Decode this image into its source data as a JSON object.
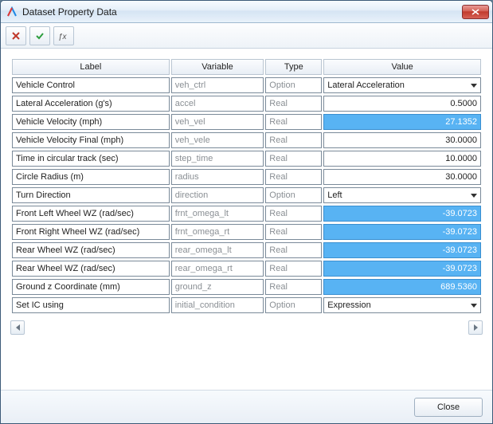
{
  "window": {
    "title": "Dataset Property Data"
  },
  "toolbar": {
    "cancel_icon": "cancel-icon",
    "apply_icon": "check-icon",
    "fx_icon": "fx-icon"
  },
  "columns": {
    "label": "Label",
    "variable": "Variable",
    "type": "Type",
    "value": "Value"
  },
  "rows": [
    {
      "label": "Vehicle Control",
      "variable": "veh_ctrl",
      "type": "Option",
      "value": "Lateral Acceleration",
      "highlight": false,
      "kind": "select"
    },
    {
      "label": "Lateral Acceleration (g's)",
      "variable": "accel",
      "type": "Real",
      "value": "0.5000",
      "highlight": false,
      "kind": "number"
    },
    {
      "label": "Vehicle Velocity (mph)",
      "variable": "veh_vel",
      "type": "Real",
      "value": "27.1352",
      "highlight": true,
      "kind": "number"
    },
    {
      "label": "Vehicle Velocity Final (mph)",
      "variable": "veh_vele",
      "type": "Real",
      "value": "30.0000",
      "highlight": false,
      "kind": "number"
    },
    {
      "label": "Time in circular track (sec)",
      "variable": "step_time",
      "type": "Real",
      "value": "10.0000",
      "highlight": false,
      "kind": "number"
    },
    {
      "label": "Circle Radius (m)",
      "variable": "radius",
      "type": "Real",
      "value": "30.0000",
      "highlight": false,
      "kind": "number"
    },
    {
      "label": "Turn Direction",
      "variable": "direction",
      "type": "Option",
      "value": "Left",
      "highlight": false,
      "kind": "select"
    },
    {
      "label": "Front Left Wheel WZ (rad/sec)",
      "variable": "frnt_omega_lt",
      "type": "Real",
      "value": "-39.0723",
      "highlight": true,
      "kind": "number"
    },
    {
      "label": "Front Right Wheel WZ (rad/sec)",
      "variable": "frnt_omega_rt",
      "type": "Real",
      "value": "-39.0723",
      "highlight": true,
      "kind": "number"
    },
    {
      "label": "Rear Wheel WZ (rad/sec)",
      "variable": "rear_omega_lt",
      "type": "Real",
      "value": "-39.0723",
      "highlight": true,
      "kind": "number"
    },
    {
      "label": "Rear Wheel WZ (rad/sec)",
      "variable": "rear_omega_rt",
      "type": "Real",
      "value": "-39.0723",
      "highlight": true,
      "kind": "number"
    },
    {
      "label": "Ground z Coordinate (mm)",
      "variable": "ground_z",
      "type": "Real",
      "value": "689.5360",
      "highlight": true,
      "kind": "number"
    },
    {
      "label": "Set IC using",
      "variable": "initial_condition",
      "type": "Option",
      "value": "Expression",
      "highlight": false,
      "kind": "select"
    }
  ],
  "footer": {
    "close_label": "Close"
  },
  "col_widths": {
    "label": "195px",
    "variable": "115px",
    "type": "70px",
    "value": "195px"
  }
}
